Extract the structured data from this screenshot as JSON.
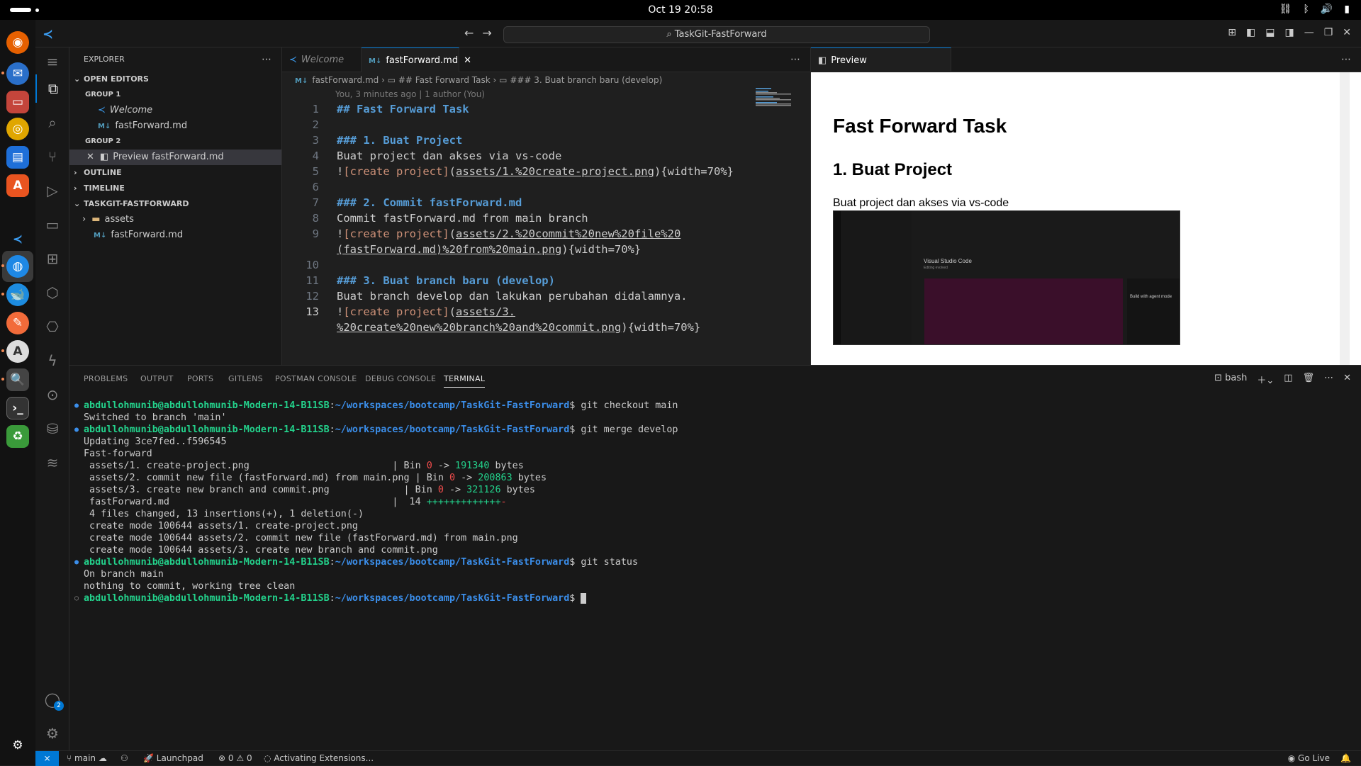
{
  "topbar": {
    "clock": "Oct 19  20:58"
  },
  "window": {
    "search": "TaskGit-FastForward"
  },
  "explorer": {
    "title": "EXPLORER",
    "open_editors": "OPEN EDITORS",
    "group1": "GROUP 1",
    "group1_items": [
      "Welcome",
      "fastForward.md"
    ],
    "group2": "GROUP 2",
    "group2_items": [
      "Preview fastForward.md"
    ],
    "outline": "OUTLINE",
    "timeline": "TIMELINE",
    "project": "TASKGIT-FASTFORWARD",
    "project_items": [
      "assets",
      "fastForward.md"
    ]
  },
  "editor": {
    "tabs": [
      "Welcome",
      "fastForward.md"
    ],
    "breadcrumb": [
      "fastForward.md",
      "## Fast Forward Task",
      "### 3. Buat branch baru (develop)"
    ],
    "blame": "You, 3 minutes ago | 1 author (You)",
    "lines": [
      {
        "n": "1",
        "parts": [
          {
            "c": "h",
            "t": "## Fast Forward Task"
          }
        ]
      },
      {
        "n": "2",
        "parts": []
      },
      {
        "n": "3",
        "parts": [
          {
            "c": "h",
            "t": "### 1. Buat Project"
          }
        ]
      },
      {
        "n": "4",
        "parts": [
          {
            "c": "",
            "t": "Buat project dan akses via vs-code"
          }
        ]
      },
      {
        "n": "5",
        "parts": [
          {
            "c": "",
            "t": "!"
          },
          {
            "c": "lt",
            "t": "[create project]"
          },
          {
            "c": "",
            "t": "("
          },
          {
            "c": "lnk",
            "t": "assets/1.%20create-project.png"
          },
          {
            "c": "",
            "t": "){width=70%}"
          }
        ]
      },
      {
        "n": "6",
        "parts": []
      },
      {
        "n": "7",
        "parts": [
          {
            "c": "h",
            "t": "### 2. Commit fastForward.md"
          }
        ]
      },
      {
        "n": "8",
        "parts": [
          {
            "c": "",
            "t": "Commit fastForward.md from main branch"
          }
        ]
      },
      {
        "n": "9",
        "parts": [
          {
            "c": "",
            "t": "!"
          },
          {
            "c": "lt",
            "t": "[create project]"
          },
          {
            "c": "",
            "t": "("
          },
          {
            "c": "lnk",
            "t": "assets/2.%20commit%20new%20file%20"
          }
        ]
      },
      {
        "n": "",
        "parts": [
          {
            "c": "lnk",
            "t": "(fastForward.md)%20from%20main.png"
          },
          {
            "c": "",
            "t": "){width=70%}"
          }
        ]
      },
      {
        "n": "10",
        "parts": []
      },
      {
        "n": "11",
        "parts": [
          {
            "c": "h",
            "t": "### 3. Buat branch baru (develop)"
          }
        ]
      },
      {
        "n": "12",
        "parts": [
          {
            "c": "",
            "t": "Buat branch develop dan lakukan perubahan didalamnya."
          }
        ]
      },
      {
        "n": "13",
        "parts": [
          {
            "c": "",
            "t": "!"
          },
          {
            "c": "lt",
            "t": "[create project]"
          },
          {
            "c": "",
            "t": "("
          },
          {
            "c": "lnk",
            "t": "assets/3."
          }
        ]
      },
      {
        "n": "",
        "parts": [
          {
            "c": "lnk",
            "t": "%20create%20new%20branch%20and%20commit.png"
          },
          {
            "c": "",
            "t": "){width=70%}"
          }
        ]
      }
    ]
  },
  "preview": {
    "tab": "Preview fastForward.md",
    "h1": "Fast Forward Task",
    "h2": "1. Buat Project",
    "p": "Buat project dan akses via vs-code",
    "img_title": "Visual Studio Code",
    "img_sub": "Editing evolved",
    "img_side": "Build with agent mode"
  },
  "panel": {
    "tabs": [
      "PROBLEMS",
      "OUTPUT",
      "PORTS",
      "GITLENS",
      "POSTMAN CONSOLE",
      "DEBUG CONSOLE",
      "TERMINAL"
    ],
    "shell": "bash"
  },
  "terminal": {
    "prompt_user": "abdullohmunib@abdullohmunib-Modern-14-B11SB",
    "prompt_path": "~/workspaces/bootcamp/TaskGit-FastForward",
    "lines": [
      {
        "mk": "blue",
        "parts": [
          {
            "c": "pr",
            "t": "abdullohmunib@abdullohmunib-Modern-14-B11SB"
          },
          {
            "c": "",
            "t": ":"
          },
          {
            "c": "pth",
            "t": "~/workspaces/bootcamp/TaskGit-FastForward"
          },
          {
            "c": "",
            "t": "$ git checkout main"
          }
        ]
      },
      {
        "mk": "",
        "parts": [
          {
            "c": "",
            "t": "Switched to branch 'main'"
          }
        ]
      },
      {
        "mk": "blue",
        "parts": [
          {
            "c": "pr",
            "t": "abdullohmunib@abdullohmunib-Modern-14-B11SB"
          },
          {
            "c": "",
            "t": ":"
          },
          {
            "c": "pth",
            "t": "~/workspaces/bootcamp/TaskGit-FastForward"
          },
          {
            "c": "",
            "t": "$ git merge develop"
          }
        ]
      },
      {
        "mk": "",
        "parts": [
          {
            "c": "",
            "t": "Updating 3ce7fed..f596545"
          }
        ]
      },
      {
        "mk": "",
        "parts": [
          {
            "c": "",
            "t": "Fast-forward"
          }
        ]
      },
      {
        "mk": "",
        "parts": [
          {
            "c": "",
            "t": " assets/1. create-project.png                         | Bin "
          },
          {
            "c": "rd",
            "t": "0"
          },
          {
            "c": "",
            "t": " -> "
          },
          {
            "c": "gr",
            "t": "191340"
          },
          {
            "c": "",
            "t": " bytes"
          }
        ]
      },
      {
        "mk": "",
        "parts": [
          {
            "c": "",
            "t": " assets/2. commit new file (fastForward.md) from main.png | Bin "
          },
          {
            "c": "rd",
            "t": "0"
          },
          {
            "c": "",
            "t": " -> "
          },
          {
            "c": "gr",
            "t": "200863"
          },
          {
            "c": "",
            "t": " bytes"
          }
        ]
      },
      {
        "mk": "",
        "parts": [
          {
            "c": "",
            "t": " assets/3. create new branch and commit.png             | Bin "
          },
          {
            "c": "rd",
            "t": "0"
          },
          {
            "c": "",
            "t": " -> "
          },
          {
            "c": "gr",
            "t": "321126"
          },
          {
            "c": "",
            "t": " bytes"
          }
        ]
      },
      {
        "mk": "",
        "parts": [
          {
            "c": "",
            "t": " fastForward.md                                       |  14 "
          },
          {
            "c": "gr",
            "t": "+++++++++++++"
          },
          {
            "c": "rd",
            "t": "-"
          }
        ]
      },
      {
        "mk": "",
        "parts": [
          {
            "c": "",
            "t": " 4 files changed, 13 insertions(+), 1 deletion(-)"
          }
        ]
      },
      {
        "mk": "",
        "parts": [
          {
            "c": "",
            "t": " create mode 100644 assets/1. create-project.png"
          }
        ]
      },
      {
        "mk": "",
        "parts": [
          {
            "c": "",
            "t": " create mode 100644 assets/2. commit new file (fastForward.md) from main.png"
          }
        ]
      },
      {
        "mk": "",
        "parts": [
          {
            "c": "",
            "t": " create mode 100644 assets/3. create new branch and commit.png"
          }
        ]
      },
      {
        "mk": "blue",
        "parts": [
          {
            "c": "pr",
            "t": "abdullohmunib@abdullohmunib-Modern-14-B11SB"
          },
          {
            "c": "",
            "t": ":"
          },
          {
            "c": "pth",
            "t": "~/workspaces/bootcamp/TaskGit-FastForward"
          },
          {
            "c": "",
            "t": "$ git status"
          }
        ]
      },
      {
        "mk": "",
        "parts": [
          {
            "c": "",
            "t": "On branch main"
          }
        ]
      },
      {
        "mk": "",
        "parts": [
          {
            "c": "",
            "t": "nothing to commit, working tree clean"
          }
        ]
      },
      {
        "mk": "empty",
        "parts": [
          {
            "c": "pr",
            "t": "abdullohmunib@abdullohmunib-Modern-14-B11SB"
          },
          {
            "c": "",
            "t": ":"
          },
          {
            "c": "pth",
            "t": "~/workspaces/bootcamp/TaskGit-FastForward"
          },
          {
            "c": "",
            "t": "$ "
          }
        ],
        "cursor": true
      }
    ]
  },
  "statusbar": {
    "branch": "main",
    "launchpad": "Launchpad",
    "problems": "0",
    "warnings": "0",
    "activity": "Activating Extensions...",
    "golive": "Go Live"
  },
  "badges": {
    "accounts": "2"
  },
  "colors": {
    "accent": "#0078d4",
    "heading": "#569cd6",
    "prompt": "#23d18b",
    "path": "#3b8eea"
  }
}
